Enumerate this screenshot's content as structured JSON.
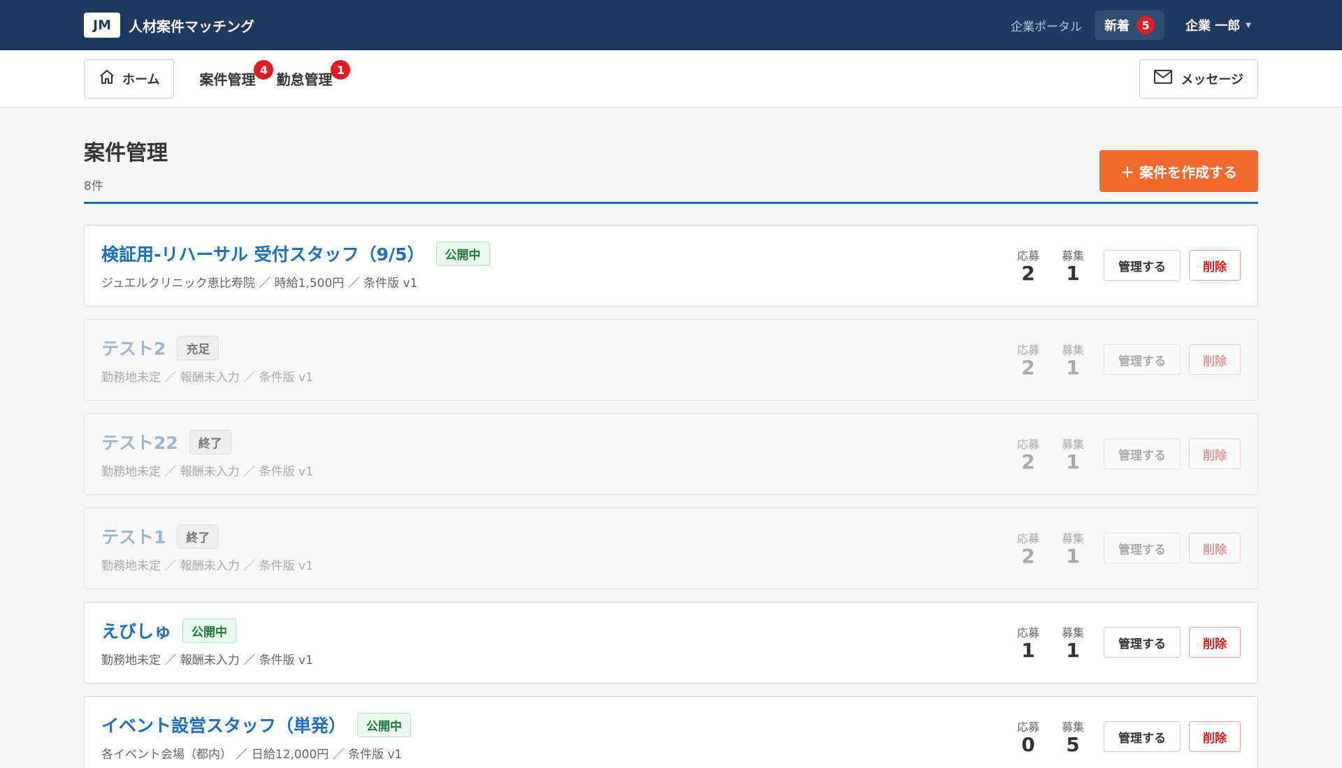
{
  "header": {
    "logo": "JM",
    "app_name": "人材案件マッチング",
    "portal_label": "企業ポータル",
    "new_label": "新着",
    "new_count": "5",
    "user_name": "企業 一郎"
  },
  "nav": {
    "home_label": "ホーム",
    "jobs_label": "案件管理",
    "jobs_badge": "4",
    "attendance_label": "勤怠管理",
    "attendance_badge": "1",
    "messages_label": "メッセージ"
  },
  "page": {
    "title": "案件管理",
    "count": "8件",
    "create_label": "＋ 案件を作成する"
  },
  "labels": {
    "applied": "応募",
    "recruiting": "募集",
    "manage": "管理する",
    "delete": "削除"
  },
  "jobs": [
    {
      "title": "検証用-リハーサル 受付スタッフ（9/5）",
      "status": "公開中",
      "meta": "ジュエルクリニック恵比寿院 ／ 時給1,500円 ／ 条件版 v1",
      "applied": "2",
      "recruiting": "1"
    },
    {
      "title": "テスト2",
      "status": "充足",
      "meta": "勤務地未定 ／ 報酬未入力 ／ 条件版 v1",
      "applied": "2",
      "recruiting": "1"
    },
    {
      "title": "テスト22",
      "status": "終了",
      "meta": "勤務地未定 ／ 報酬未入力 ／ 条件版 v1",
      "applied": "2",
      "recruiting": "1"
    },
    {
      "title": "テスト1",
      "status": "終了",
      "meta": "勤務地未定 ／ 報酬未入力 ／ 条件版 v1",
      "applied": "2",
      "recruiting": "1"
    },
    {
      "title": "えびしゅ",
      "status": "公開中",
      "meta": "勤務地未定 ／ 報酬未入力 ／ 条件版 v1",
      "applied": "1",
      "recruiting": "1"
    },
    {
      "title": "イベント設営スタッフ（単発）",
      "status": "公開中",
      "meta": "各イベント会場（都内） ／ 日給12,000円 ／ 条件版 v1",
      "applied": "0",
      "recruiting": "5"
    }
  ]
}
